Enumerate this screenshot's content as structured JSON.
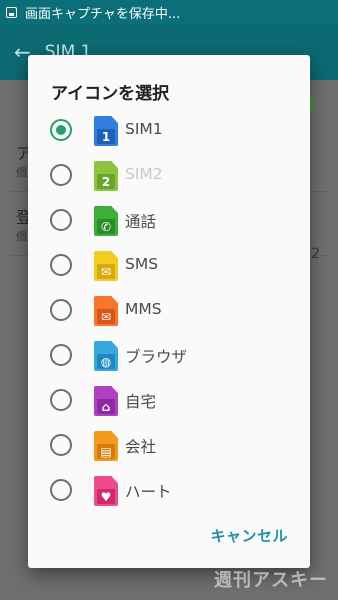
{
  "status_bar": {
    "text": "画面キャプチャを保存中..."
  },
  "app_bar": {
    "back_glyph": "←",
    "title": "SIM 1"
  },
  "background": {
    "rows": [
      {
        "title": "ア",
        "subtitle": "個"
      },
      {
        "title": "登",
        "subtitle": "個"
      }
    ],
    "right_text": "2"
  },
  "dialog": {
    "title": "アイコンを選択",
    "options": [
      {
        "label": "SIM1",
        "icon": "sim1-icon",
        "glyph": "1",
        "color": "#2f7ee0",
        "inner": "#1e5fb8",
        "selected": true,
        "disabled": false
      },
      {
        "label": "SIM2",
        "icon": "sim2-icon",
        "glyph": "2",
        "color": "#8cc63f",
        "inner": "#6aa52a",
        "selected": false,
        "disabled": true
      },
      {
        "label": "通話",
        "icon": "phone-icon",
        "glyph": "✆",
        "color": "#3cae3b",
        "inner": "#2a8d2a",
        "selected": false,
        "disabled": false
      },
      {
        "label": "SMS",
        "icon": "sms-icon",
        "glyph": "✉",
        "color": "#f2cc1f",
        "inner": "#d6a90f",
        "selected": false,
        "disabled": false
      },
      {
        "label": "MMS",
        "icon": "mms-icon",
        "glyph": "✉",
        "color": "#f7762a",
        "inner": "#d9561a",
        "selected": false,
        "disabled": false
      },
      {
        "label": "ブラウザ",
        "icon": "browser-icon",
        "glyph": "◍",
        "color": "#35a8e0",
        "inner": "#1f87c0",
        "selected": false,
        "disabled": false
      },
      {
        "label": "自宅",
        "icon": "home-icon",
        "glyph": "⌂",
        "color": "#b03fc2",
        "inner": "#8d2aa0",
        "selected": false,
        "disabled": false
      },
      {
        "label": "会社",
        "icon": "office-icon",
        "glyph": "▤",
        "color": "#f29a1e",
        "inner": "#d67c0a",
        "selected": false,
        "disabled": false
      },
      {
        "label": "ハート",
        "icon": "heart-icon",
        "glyph": "♥",
        "color": "#ef4a8c",
        "inner": "#d02a6f",
        "selected": false,
        "disabled": false
      }
    ],
    "cancel_label": "キャンセル"
  },
  "watermark": "週刊アスキー"
}
